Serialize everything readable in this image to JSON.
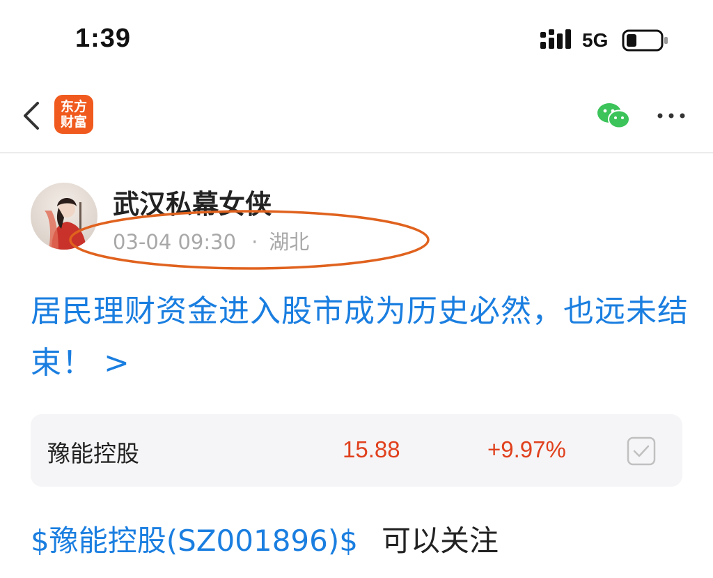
{
  "status_bar": {
    "time": "1:39",
    "network": "5G",
    "signal_icon": "signal-bars-icon",
    "battery_icon": "battery-low-icon"
  },
  "nav": {
    "back_icon": "chevron-left-icon",
    "logo_line1": "东方",
    "logo_line2": "财富",
    "share_icon": "wechat-icon",
    "more_icon": "more-dots-icon"
  },
  "post": {
    "author": "武汉私幕女侠",
    "date": "03-04 09:30",
    "location": "湖北",
    "separator": "·",
    "headline": "居民理财资金进入股市成为历史必然，也远未结束！ >",
    "stock_card": {
      "name": "豫能控股",
      "price": "15.88",
      "change": "+9.97%"
    },
    "stock_tag": "$豫能控股(SZ001896)$",
    "body_text": "可以关注"
  },
  "colors": {
    "link_blue": "#1a7ee0",
    "price_red": "#e0401d",
    "logo_orange": "#f05a1e",
    "annotation_orange": "#e0621e",
    "wechat_green": "#3cc35a"
  }
}
